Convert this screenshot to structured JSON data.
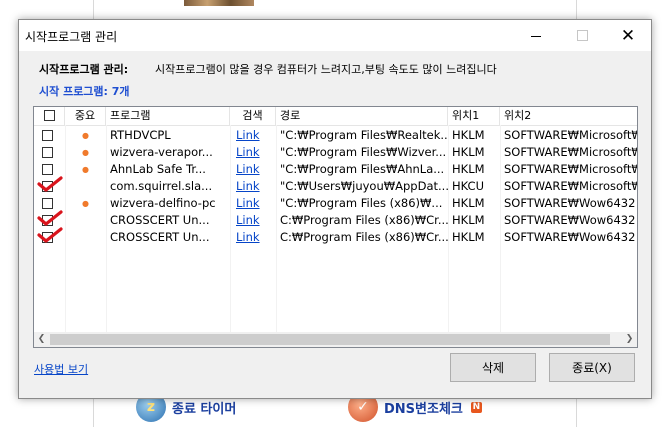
{
  "background_app": {
    "timer_label": "종료 타이머",
    "dns_label": "DNS변조체크",
    "dns_badge": "N"
  },
  "dialog": {
    "title": "시작프로그램 관리",
    "description_label": "시작프로그램 관리:",
    "description_text": "시작프로그램이 많을 경우 컴퓨터가 느려지고,부팅 속도도 많이 느려집니다",
    "count_text": "시작 프로그램: 7개",
    "usage_link": "사용법 보기",
    "delete_button": "삭제",
    "close_button": "종료(X)"
  },
  "table": {
    "columns": [
      "",
      "중요",
      "프로그램",
      "검색",
      "경로",
      "위치1",
      "위치2"
    ],
    "rows": [
      {
        "checked": false,
        "important": true,
        "program": "RTHDVCPL",
        "search": "Link",
        "path": "\"C:₩Program Files₩Realtek...",
        "loc1": "HKLM",
        "loc2": "SOFTWARE₩Microsoft₩"
      },
      {
        "checked": false,
        "important": true,
        "program": "wizvera-verapor...",
        "search": "Link",
        "path": "\"C:₩Program Files₩Wizver...",
        "loc1": "HKLM",
        "loc2": "SOFTWARE₩Microsoft₩"
      },
      {
        "checked": false,
        "important": true,
        "program": "AhnLab Safe Tr...",
        "search": "Link",
        "path": "\"C:₩Program Files₩AhnLa...",
        "loc1": "HKLM",
        "loc2": "SOFTWARE₩Microsoft₩"
      },
      {
        "checked": true,
        "important": false,
        "program": "com.squirrel.sla...",
        "search": "Link",
        "path": "\"C:₩Users₩juyou₩AppDat...",
        "loc1": "HKCU",
        "loc2": "SOFTWARE₩Microsoft₩"
      },
      {
        "checked": false,
        "important": true,
        "program": "wizvera-delfino-pc",
        "search": "Link",
        "path": "\"C:₩Program Files (x86)₩...",
        "loc1": "HKLM",
        "loc2": "SOFTWARE₩Wow6432"
      },
      {
        "checked": true,
        "important": false,
        "program": "CROSSCERT Un...",
        "search": "Link",
        "path": "C:₩Program Files (x86)₩Cr...",
        "loc1": "HKLM",
        "loc2": "SOFTWARE₩Wow6432"
      },
      {
        "checked": true,
        "important": false,
        "program": "CROSSCERT Un...",
        "search": "Link",
        "path": "C:₩Program Files (x86)₩Cr...",
        "loc1": "HKLM",
        "loc2": "SOFTWARE₩Wow6432"
      }
    ]
  },
  "colors": {
    "important_dot": "#f07a2c",
    "check_mark": "#d9141c",
    "link": "#0645c8",
    "count_text": "#1f4fd1"
  }
}
